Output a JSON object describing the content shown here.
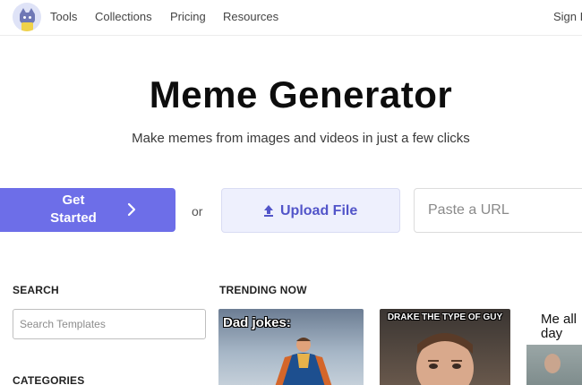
{
  "nav": {
    "tools": "Tools",
    "collections": "Collections",
    "pricing": "Pricing",
    "resources": "Resources",
    "signin": "Sign I"
  },
  "hero": {
    "title": "Meme Generator",
    "subtitle": "Make memes from images and videos in just a few clicks"
  },
  "actions": {
    "get_started_line1": "Get",
    "get_started_line2": "Started",
    "or": "or",
    "upload_label": "Upload File",
    "url_placeholder": "Paste a URL"
  },
  "sidebar": {
    "search_heading": "SEARCH",
    "search_placeholder": "Search Templates",
    "categories_heading": "CATEGORIES"
  },
  "trending": {
    "heading": "TRENDING NOW",
    "cards": [
      {
        "caption": "Dad jokes:"
      },
      {
        "caption": "DRAKE THE TYPE OF GUY"
      },
      {
        "caption_line1": "Me all",
        "caption_line2": "day"
      }
    ]
  },
  "colors": {
    "accent": "#6d6ee8",
    "upload_bg": "#eef0fd",
    "upload_text": "#5255c9"
  },
  "icons": {
    "logo": "cat-mascot-icon",
    "get_started": "chevron-right-icon",
    "upload": "upload-arrow-icon"
  }
}
